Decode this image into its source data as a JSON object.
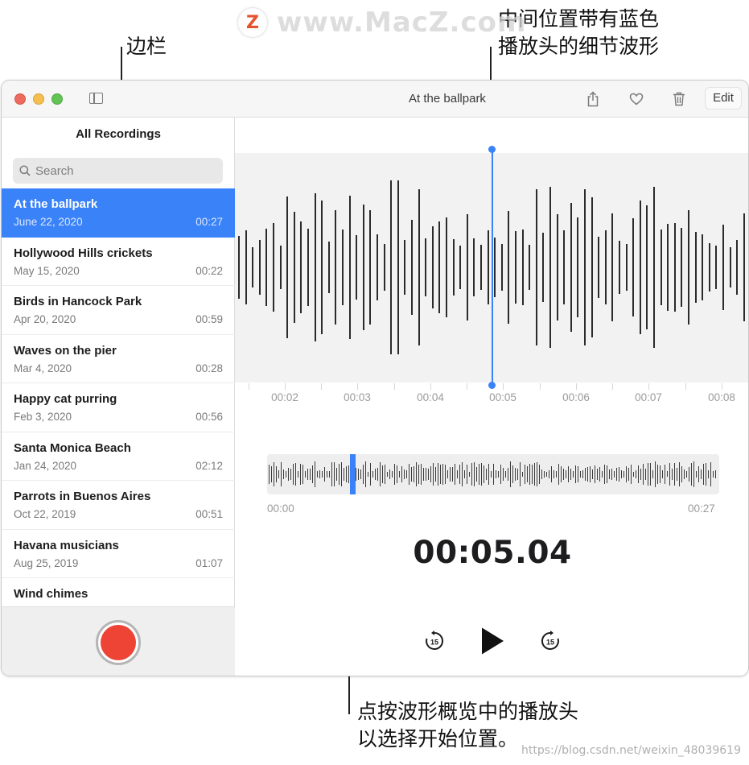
{
  "annotations": {
    "sidebar_callout": "边栏",
    "detail_callout_line1": "中间位置带有蓝色",
    "detail_callout_line2": "播放头的细节波形",
    "overview_callout_line1": "点按波形概览中的播放头",
    "overview_callout_line2": "以选择开始位置。"
  },
  "watermarks": {
    "top": "www.MacZ.com",
    "bottom": "https://blog.csdn.net/weixin_48039619"
  },
  "window": {
    "title": "At the ballpark",
    "edit_label": "Edit"
  },
  "sidebar": {
    "heading": "All Recordings",
    "search_placeholder": "Search",
    "recordings": [
      {
        "name": "At the ballpark",
        "date": "June 22, 2020",
        "duration": "00:27",
        "selected": true
      },
      {
        "name": "Hollywood Hills crickets",
        "date": "May 15, 2020",
        "duration": "00:22"
      },
      {
        "name": "Birds in Hancock Park",
        "date": "Apr 20, 2020",
        "duration": "00:59"
      },
      {
        "name": "Waves on the pier",
        "date": "Mar 4, 2020",
        "duration": "00:28"
      },
      {
        "name": "Happy cat purring",
        "date": "Feb 3, 2020",
        "duration": "00:56"
      },
      {
        "name": "Santa Monica Beach",
        "date": "Jan 24, 2020",
        "duration": "02:12"
      },
      {
        "name": "Parrots in Buenos Aires",
        "date": "Oct 22, 2019",
        "duration": "00:51"
      },
      {
        "name": "Havana musicians",
        "date": "Aug 25, 2019",
        "duration": "01:07"
      },
      {
        "name": "Wind chimes",
        "date": "",
        "duration": ""
      }
    ]
  },
  "timeline": {
    "labels": [
      "00:02",
      "00:03",
      "00:04",
      "00:05",
      "00:06",
      "00:07",
      "00:08"
    ]
  },
  "overview": {
    "start": "00:00",
    "end": "00:27"
  },
  "player": {
    "current_time": "00:05.04",
    "skip_seconds": "15"
  },
  "colors": {
    "accent": "#3a82f7",
    "record": "#ee4436"
  }
}
